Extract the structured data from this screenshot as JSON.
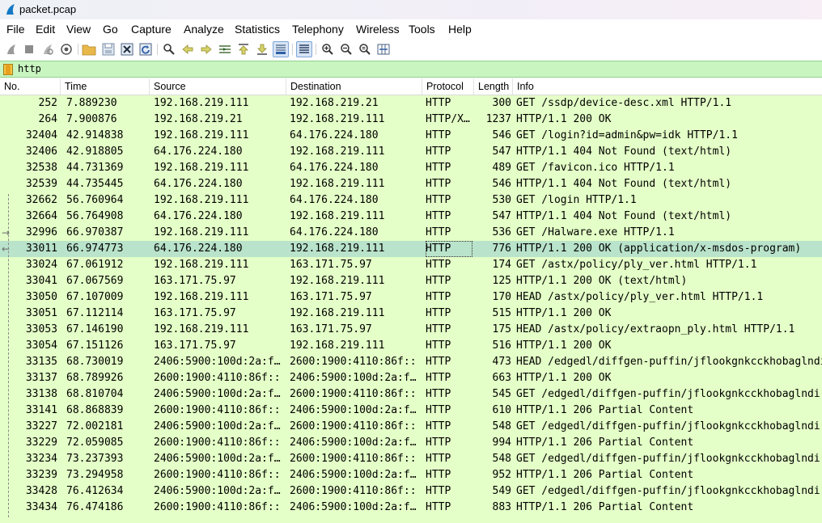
{
  "window": {
    "title": "packet.pcap"
  },
  "menu": [
    "File",
    "Edit",
    "View",
    "Go",
    "Capture",
    "Analyze",
    "Statistics",
    "Telephony",
    "Wireless",
    "Tools",
    "Help"
  ],
  "toolbar": {
    "icons": [
      "shark-fin-start-icon",
      "stop-capture-icon",
      "restart-capture-icon",
      "capture-options-icon",
      "open-file-icon",
      "save-file-icon",
      "close-file-icon",
      "reload-file-icon",
      "find-packet-icon",
      "go-back-icon",
      "go-forward-icon",
      "go-to-packet-icon",
      "first-packet-icon",
      "last-packet-icon",
      "autoscroll-icon",
      "colorize-icon",
      "zoom-in-icon",
      "zoom-out-icon",
      "normal-size-icon",
      "resize-columns-icon"
    ]
  },
  "filter": {
    "value": "http"
  },
  "columns": {
    "no": "No.",
    "time": "Time",
    "source": "Source",
    "destination": "Destination",
    "protocol": "Protocol",
    "length": "Length",
    "info": "Info"
  },
  "colors": {
    "row_bg": "#e4ffc7",
    "selected_bg": "#b9e3ca",
    "filter_bg": "#c9f5c0"
  },
  "packets": [
    {
      "no": "252",
      "time": "7.889230",
      "src": "192.168.219.111",
      "dst": "192.168.219.21",
      "proto": "HTTP",
      "len": "300",
      "info": "GET /ssdp/device-desc.xml HTTP/1.1"
    },
    {
      "no": "264",
      "time": "7.900876",
      "src": "192.168.219.21",
      "dst": "192.168.219.111",
      "proto": "HTTP/X…",
      "len": "1237",
      "info": "HTTP/1.1 200 OK"
    },
    {
      "no": "32404",
      "time": "42.914838",
      "src": "192.168.219.111",
      "dst": "64.176.224.180",
      "proto": "HTTP",
      "len": "546",
      "info": "GET /login?id=admin&pw=idk HTTP/1.1"
    },
    {
      "no": "32406",
      "time": "42.918805",
      "src": "64.176.224.180",
      "dst": "192.168.219.111",
      "proto": "HTTP",
      "len": "547",
      "info": "HTTP/1.1 404 Not Found  (text/html)"
    },
    {
      "no": "32538",
      "time": "44.731369",
      "src": "192.168.219.111",
      "dst": "64.176.224.180",
      "proto": "HTTP",
      "len": "489",
      "info": "GET /favicon.ico HTTP/1.1"
    },
    {
      "no": "32539",
      "time": "44.735445",
      "src": "64.176.224.180",
      "dst": "192.168.219.111",
      "proto": "HTTP",
      "len": "546",
      "info": "HTTP/1.1 404 Not Found  (text/html)"
    },
    {
      "no": "32662",
      "time": "56.760964",
      "src": "192.168.219.111",
      "dst": "64.176.224.180",
      "proto": "HTTP",
      "len": "530",
      "info": "GET /login HTTP/1.1"
    },
    {
      "no": "32664",
      "time": "56.764908",
      "src": "64.176.224.180",
      "dst": "192.168.219.111",
      "proto": "HTTP",
      "len": "547",
      "info": "HTTP/1.1 404 Not Found  (text/html)"
    },
    {
      "no": "32996",
      "time": "66.970387",
      "src": "192.168.219.111",
      "dst": "64.176.224.180",
      "proto": "HTTP",
      "len": "536",
      "info": "GET /Halware.exe HTTP/1.1"
    },
    {
      "no": "33011",
      "time": "66.974773",
      "src": "64.176.224.180",
      "dst": "192.168.219.111",
      "proto": "HTTP",
      "len": "776",
      "info": "HTTP/1.1 200 OK  (application/x-msdos-program)",
      "selected": true
    },
    {
      "no": "33024",
      "time": "67.061912",
      "src": "192.168.219.111",
      "dst": "163.171.75.97",
      "proto": "HTTP",
      "len": "174",
      "info": "GET /astx/policy/ply_ver.html HTTP/1.1"
    },
    {
      "no": "33041",
      "time": "67.067569",
      "src": "163.171.75.97",
      "dst": "192.168.219.111",
      "proto": "HTTP",
      "len": "125",
      "info": "HTTP/1.1 200 OK  (text/html)"
    },
    {
      "no": "33050",
      "time": "67.107009",
      "src": "192.168.219.111",
      "dst": "163.171.75.97",
      "proto": "HTTP",
      "len": "170",
      "info": "HEAD /astx/policy/ply_ver.html HTTP/1.1"
    },
    {
      "no": "33051",
      "time": "67.112114",
      "src": "163.171.75.97",
      "dst": "192.168.219.111",
      "proto": "HTTP",
      "len": "515",
      "info": "HTTP/1.1 200 OK"
    },
    {
      "no": "33053",
      "time": "67.146190",
      "src": "192.168.219.111",
      "dst": "163.171.75.97",
      "proto": "HTTP",
      "len": "175",
      "info": "HEAD /astx/policy/extraopn_ply.html HTTP/1.1"
    },
    {
      "no": "33054",
      "time": "67.151126",
      "src": "163.171.75.97",
      "dst": "192.168.219.111",
      "proto": "HTTP",
      "len": "516",
      "info": "HTTP/1.1 200 OK"
    },
    {
      "no": "33135",
      "time": "68.730019",
      "src": "2406:5900:100d:2a:f…",
      "dst": "2600:1900:4110:86f::",
      "proto": "HTTP",
      "len": "473",
      "info": "HEAD /edgedl/diffgen-puffin/jflookgnkcckhobaglndi"
    },
    {
      "no": "33137",
      "time": "68.789926",
      "src": "2600:1900:4110:86f::",
      "dst": "2406:5900:100d:2a:f…",
      "proto": "HTTP",
      "len": "663",
      "info": "HTTP/1.1 200 OK"
    },
    {
      "no": "33138",
      "time": "68.810704",
      "src": "2406:5900:100d:2a:f…",
      "dst": "2600:1900:4110:86f::",
      "proto": "HTTP",
      "len": "545",
      "info": "GET /edgedl/diffgen-puffin/jflookgnkcckhobaglndi"
    },
    {
      "no": "33141",
      "time": "68.868839",
      "src": "2600:1900:4110:86f::",
      "dst": "2406:5900:100d:2a:f…",
      "proto": "HTTP",
      "len": "610",
      "info": "HTTP/1.1 206 Partial Content"
    },
    {
      "no": "33227",
      "time": "72.002181",
      "src": "2406:5900:100d:2a:f…",
      "dst": "2600:1900:4110:86f::",
      "proto": "HTTP",
      "len": "548",
      "info": "GET /edgedl/diffgen-puffin/jflookgnkcckhobaglndi"
    },
    {
      "no": "33229",
      "time": "72.059085",
      "src": "2600:1900:4110:86f::",
      "dst": "2406:5900:100d:2a:f…",
      "proto": "HTTP",
      "len": "994",
      "info": "HTTP/1.1 206 Partial Content"
    },
    {
      "no": "33234",
      "time": "73.237393",
      "src": "2406:5900:100d:2a:f…",
      "dst": "2600:1900:4110:86f::",
      "proto": "HTTP",
      "len": "548",
      "info": "GET /edgedl/diffgen-puffin/jflookgnkcckhobaglndi"
    },
    {
      "no": "33239",
      "time": "73.294958",
      "src": "2600:1900:4110:86f::",
      "dst": "2406:5900:100d:2a:f…",
      "proto": "HTTP",
      "len": "952",
      "info": "HTTP/1.1 206 Partial Content"
    },
    {
      "no": "33428",
      "time": "76.412634",
      "src": "2406:5900:100d:2a:f…",
      "dst": "2600:1900:4110:86f::",
      "proto": "HTTP",
      "len": "549",
      "info": "GET /edgedl/diffgen-puffin/jflookgnkcckhobaglndi"
    },
    {
      "no": "33434",
      "time": "76.474186",
      "src": "2600:1900:4110:86f::",
      "dst": "2406:5900:100d:2a:f…",
      "proto": "HTTP",
      "len": "883",
      "info": "HTTP/1.1 206 Partial Content"
    }
  ]
}
